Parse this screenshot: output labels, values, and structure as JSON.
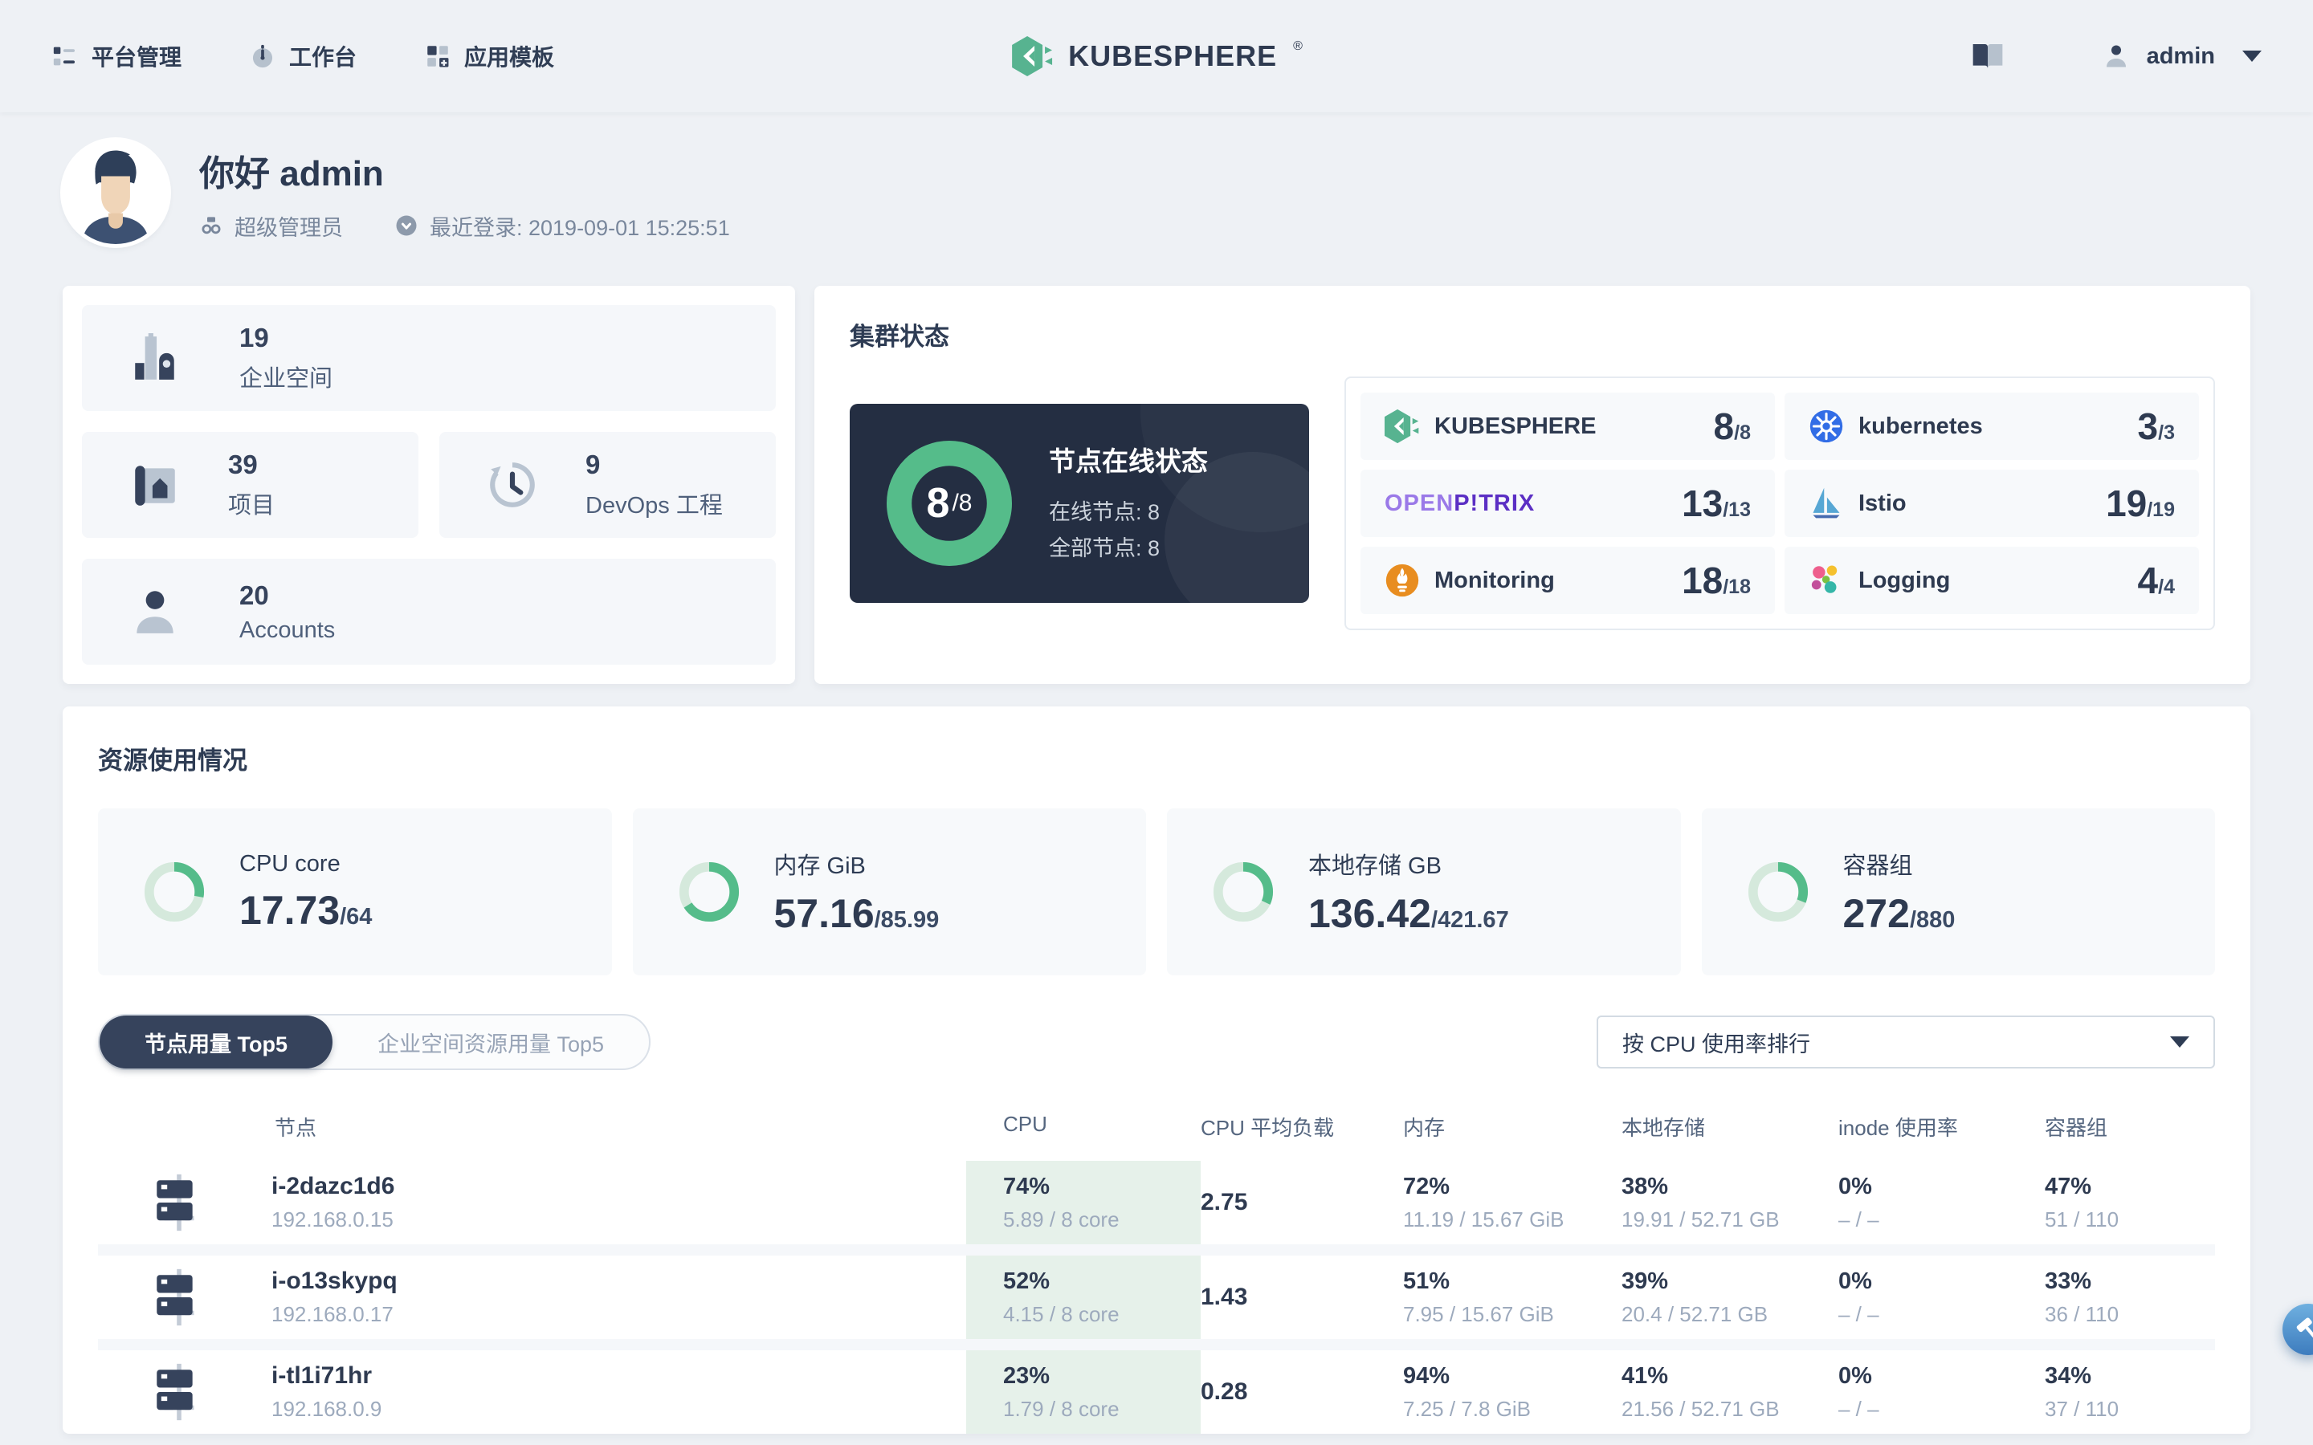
{
  "header": {
    "nav": [
      {
        "label": "平台管理"
      },
      {
        "label": "工作台"
      },
      {
        "label": "应用模板"
      }
    ],
    "brand": "KUBESPHERE",
    "brand_mark": "®",
    "user": "admin"
  },
  "greeting": {
    "title": "你好 admin",
    "role": "超级管理员",
    "last_login": "最近登录: 2019-09-01 15:25:51"
  },
  "summary": [
    {
      "value": "19",
      "label": "企业空间"
    },
    {
      "value": "39",
      "label": "项目"
    },
    {
      "value": "9",
      "label": "DevOps 工程"
    },
    {
      "value": "20",
      "label": "Accounts"
    }
  ],
  "cluster": {
    "title": "集群状态",
    "node_status": {
      "title": "节点在线状态",
      "value": "8",
      "total": "/8",
      "online": "在线节点: 8",
      "all": "全部节点: 8",
      "ring_pct": 100
    },
    "components": [
      {
        "name": "KUBESPHERE",
        "value": "8",
        "total": "/8"
      },
      {
        "name": "kubernetes",
        "value": "3",
        "total": "/3"
      },
      {
        "name": "OPENP!TRIX",
        "name_a": "OPEN",
        "name_b": "P!TRIX",
        "value": "13",
        "total": "/13"
      },
      {
        "name": "Istio",
        "value": "19",
        "total": "/19"
      },
      {
        "name": "Monitoring",
        "value": "18",
        "total": "/18"
      },
      {
        "name": "Logging",
        "value": "4",
        "total": "/4"
      }
    ]
  },
  "resources": {
    "title": "资源使用情况",
    "cards": [
      {
        "label": "CPU core",
        "used": "17.73",
        "total": "/64",
        "pct": 28
      },
      {
        "label": "内存 GiB",
        "used": "57.16",
        "total": "/85.99",
        "pct": 66
      },
      {
        "label": "本地存储 GB",
        "used": "136.42",
        "total": "/421.67",
        "pct": 32
      },
      {
        "label": "容器组",
        "used": "272",
        "total": "/880",
        "pct": 31
      }
    ]
  },
  "usage": {
    "tabs": [
      {
        "label": "节点用量 Top5"
      },
      {
        "label": "企业空间资源用量 Top5"
      }
    ],
    "sort_label": "按 CPU 使用率排行",
    "columns": [
      "节点",
      "CPU",
      "CPU 平均负载",
      "内存",
      "本地存储",
      "inode 使用率",
      "容器组"
    ],
    "rows": [
      {
        "name": "i-2dazc1d6",
        "ip": "192.168.0.15",
        "cpu_pct": "74%",
        "cpu_detail": "5.89 / 8 core",
        "load": "2.75",
        "mem_pct": "72%",
        "mem_detail": "11.19 / 15.67 GiB",
        "disk_pct": "38%",
        "disk_detail": "19.91 / 52.71 GB",
        "inode_pct": "0%",
        "inode_detail": "– / –",
        "pods_pct": "47%",
        "pods_detail": "51 / 110"
      },
      {
        "name": "i-o13skypq",
        "ip": "192.168.0.17",
        "cpu_pct": "52%",
        "cpu_detail": "4.15 / 8 core",
        "load": "1.43",
        "mem_pct": "51%",
        "mem_detail": "7.95 / 15.67 GiB",
        "disk_pct": "39%",
        "disk_detail": "20.4 / 52.71 GB",
        "inode_pct": "0%",
        "inode_detail": "– / –",
        "pods_pct": "33%",
        "pods_detail": "36 / 110"
      },
      {
        "name": "i-tl1i71hr",
        "ip": "192.168.0.9",
        "cpu_pct": "23%",
        "cpu_detail": "1.79 / 8 core",
        "load": "0.28",
        "mem_pct": "94%",
        "mem_detail": "7.25 / 7.8 GiB",
        "disk_pct": "41%",
        "disk_detail": "21.56 / 52.71 GB",
        "inode_pct": "0%",
        "inode_detail": "– / –",
        "pods_pct": "34%",
        "pods_detail": "37 / 110"
      }
    ]
  },
  "colors": {
    "accent_green": "#55bc8a",
    "dark_navy": "#242e42",
    "cpu_cell_bg": "#e6f1ea"
  }
}
